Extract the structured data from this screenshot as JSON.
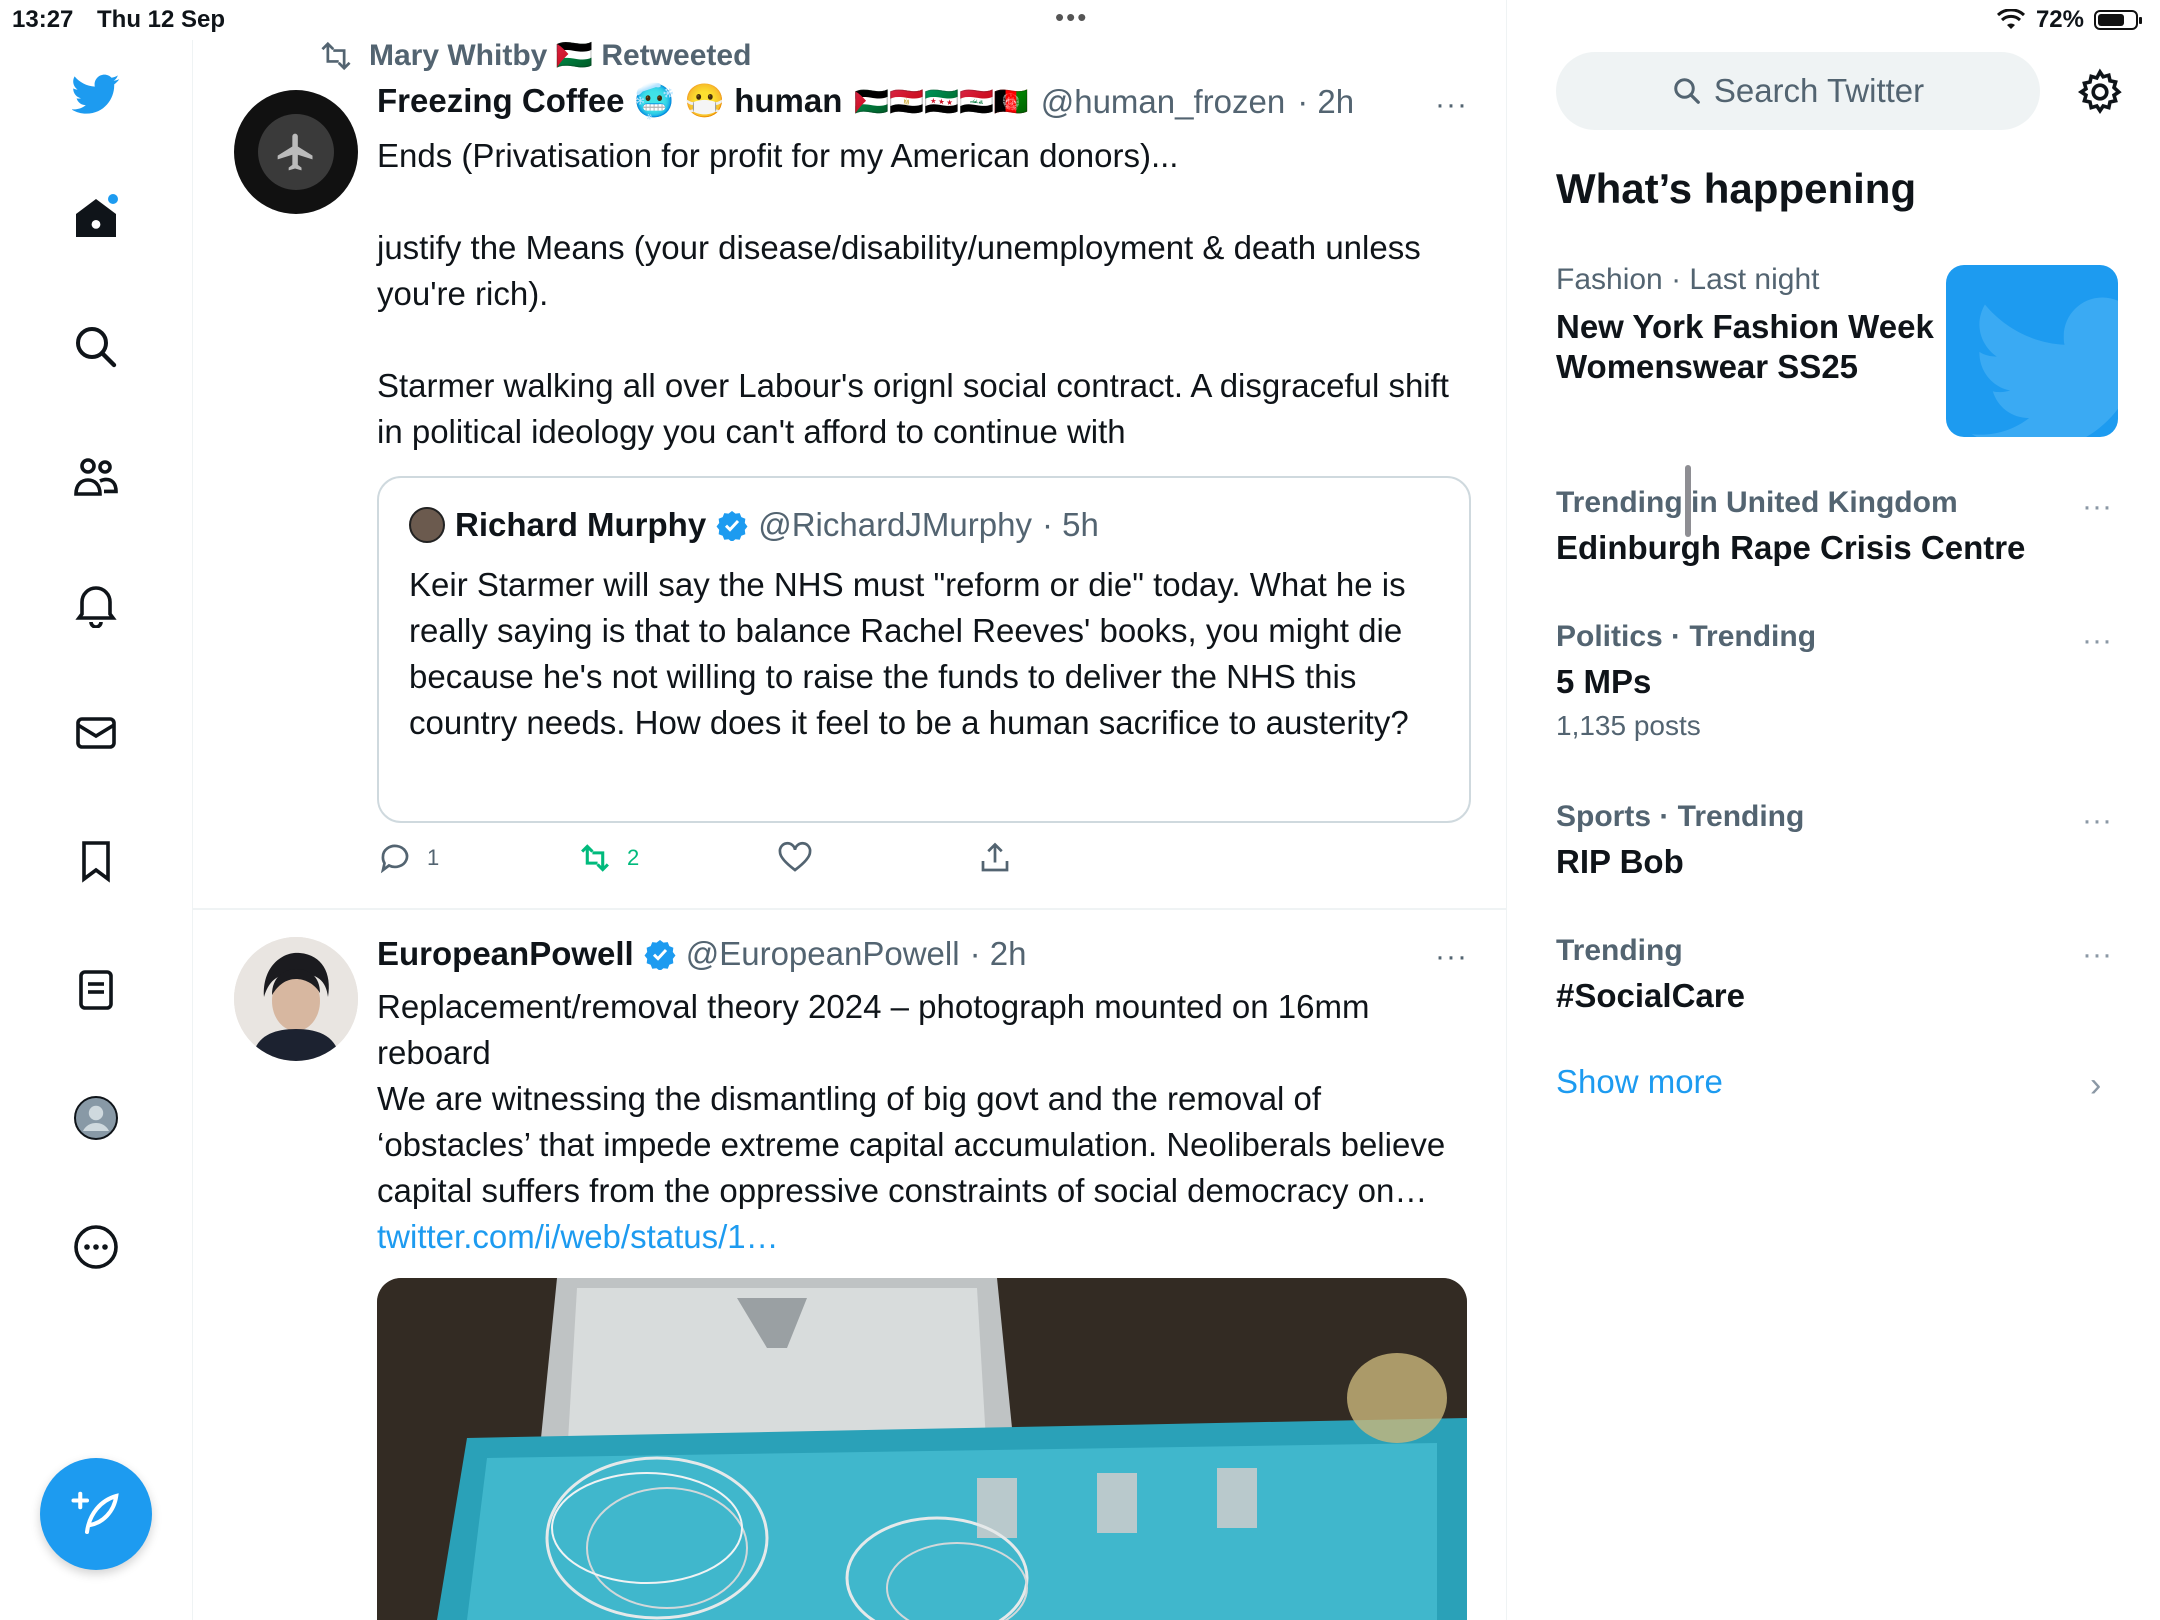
{
  "status_bar": {
    "time": "13:27",
    "date": "Thu 12 Sep",
    "battery": "72%",
    "battery_level": 0.72,
    "dots": "•••"
  },
  "nav": {
    "items": [
      "twitter-logo",
      "home-icon",
      "search-icon",
      "communities-icon",
      "notifications-icon",
      "messages-icon",
      "bookmarks-icon",
      "lists-icon",
      "profile-icon",
      "more-icon"
    ],
    "compose": "compose-icon",
    "accent": "#1d9bf0"
  },
  "timeline": {
    "tweet1": {
      "retweeted_by": "Mary Whitby 🇵🇸 Retweeted",
      "name": "Freezing Coffee 🥶 😷 human",
      "flags": "🇵🇸🇪🇬🇸🇾🇮🇶🇦🇫",
      "handle": "@human_frozen",
      "time": "· 2h",
      "more": "···",
      "text": "Ends (Privatisation for profit for my American donors)...\n\njustify the Means (your disease/disability/unemployment & death unless you're rich).\n\nStarmer walking all over Labour's orignl social contract. A disgraceful shift in political ideology you can't afford to continue with",
      "quote": {
        "name": "Richard Murphy",
        "handle": "@RichardJMurphy",
        "time": "· 5h",
        "text": "Keir Starmer will say the NHS must \"reform or die\" today. What he is really saying is that to balance Rachel Reeves' books, you might die because he's not willing to raise the funds to deliver the NHS this country needs. How does it feel to be a human sacrifice to austerity?"
      },
      "replies": "1",
      "retweets": "2",
      "retweet_color": "#00ba7c"
    },
    "tweet2": {
      "name": "EuropeanPowell",
      "handle": "@EuropeanPowell",
      "time": "· 2h",
      "more": "···",
      "text": "Replacement/removal theory 2024 – photograph mounted on 16mm reboard\nWe are witnessing the dismantling of big govt and the removal of ‘obstacles’ that impede extreme capital accumulation. Neoliberals believe capital suffers from the oppressive constraints of social democracy on… ",
      "link": "twitter.com/i/web/status/1…"
    }
  },
  "sidebar": {
    "search_placeholder": "Search Twitter",
    "section_title": "What’s happening",
    "trends": [
      {
        "meta": "Fashion · Last night",
        "title": "New York Fashion Week Womenswear SS25",
        "posts": ""
      },
      {
        "meta": "Trending in United Kingdom",
        "title": "Edinburgh Rape Crisis Centre",
        "posts": ""
      },
      {
        "meta": "Politics · Trending",
        "title": "5 MPs",
        "posts": "1,135 posts"
      },
      {
        "meta": "Sports · Trending",
        "title": "RIP Bob",
        "posts": ""
      },
      {
        "meta": "Trending",
        "title": "#SocialCare",
        "posts": ""
      }
    ],
    "trend_more": "···",
    "show_more": "Show more",
    "chevron": "›"
  }
}
